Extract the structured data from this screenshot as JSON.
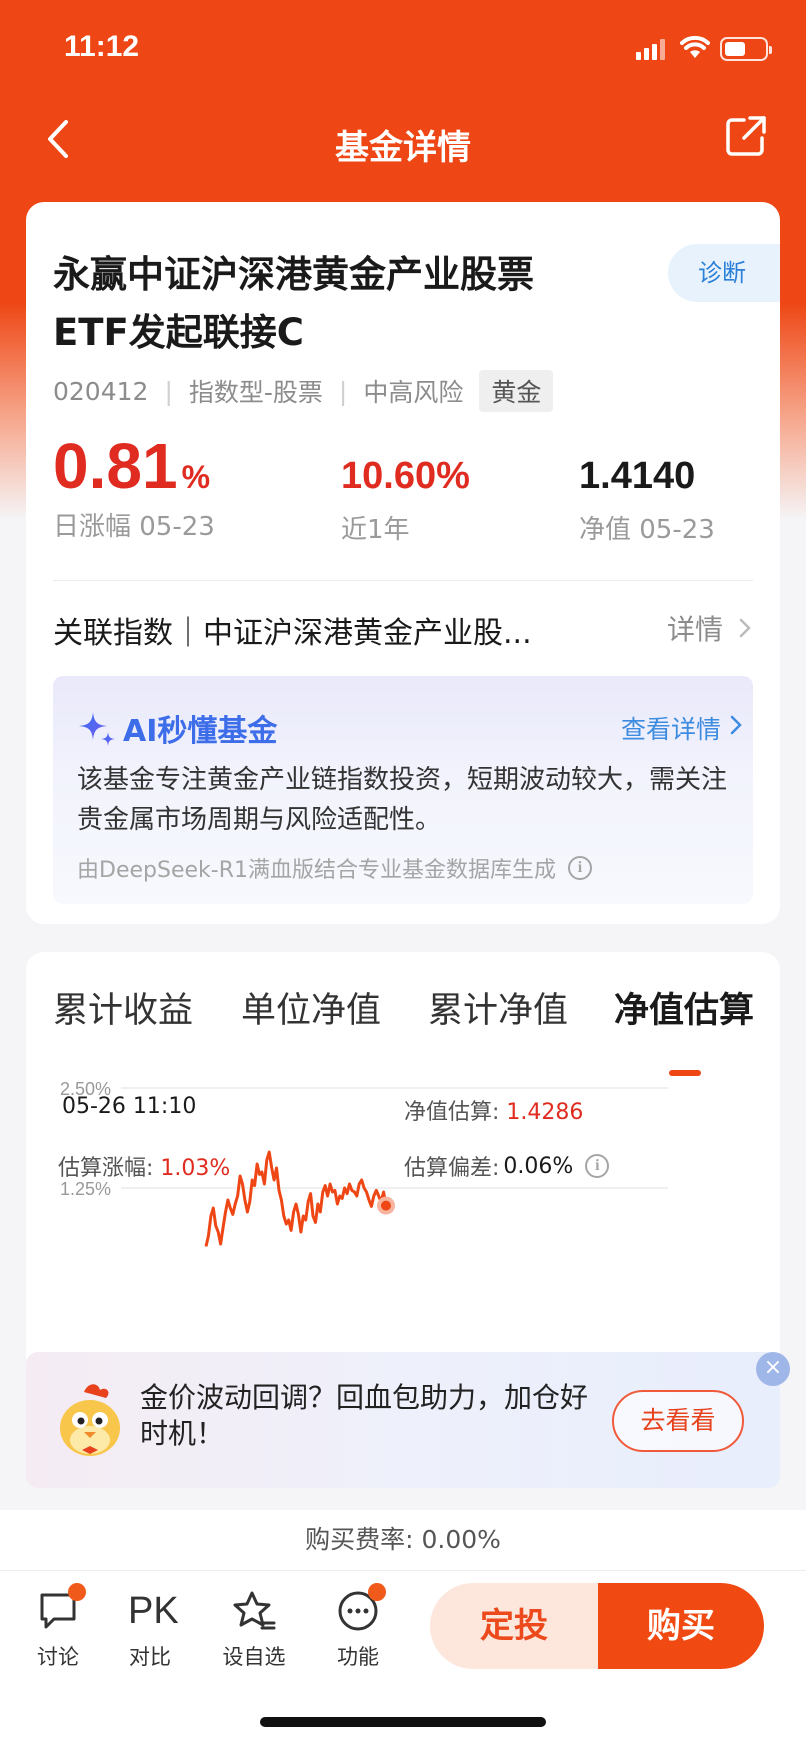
{
  "status_bar": {
    "time": "11:12"
  },
  "nav": {
    "title": "基金详情",
    "back_icon": "chevron-left-icon",
    "share_icon": "share-icon"
  },
  "fund": {
    "name": "永赢中证沪深港黄金产业股票ETF发起联接C",
    "diagnose_label": "诊断",
    "code": "020412",
    "type": "指数型-股票",
    "risk": "中高风险",
    "tag": "黄金",
    "daily_change_value": "0.81",
    "daily_change_unit": "%",
    "daily_change_label": "日涨幅 05-23",
    "year_return_value": "10.60%",
    "year_return_label": "近1年",
    "nav_value": "1.4140",
    "nav_label": "净值 05-23",
    "related_index": "关联指数｜中证沪深港黄金产业股...",
    "related_more": "详情"
  },
  "ai": {
    "title": "AI秒懂基金",
    "more": "查看详情",
    "text": "该基金专注黄金产业链指数投资，短期波动较大，需关注贵金属市场周期与风险适配性。",
    "footer": "由DeepSeek-R1满血版结合专业基金数据库生成"
  },
  "chart_tabs": [
    "累计收益",
    "单位净值",
    "累计净值",
    "净值估算"
  ],
  "active_tab": 3,
  "estimate": {
    "time": "05-26 11:10",
    "est_label": "净值估算:",
    "est_value": "1.4286",
    "change_label": "估算涨幅:",
    "change_value": "1.03%",
    "dev_label": "估算偏差:",
    "dev_value": "0.06%"
  },
  "chart_data": {
    "type": "line",
    "title": "",
    "xlabel": "",
    "ylabel": "",
    "ytick_labels": [
      "2.50%",
      "1.25%"
    ],
    "ylim": [
      0,
      2.5
    ],
    "color": "#ee4614",
    "series": [
      {
        "values": [
          0.52,
          0.65,
          0.9,
          1.0,
          0.78,
          0.7,
          0.55,
          0.75,
          0.95,
          1.1,
          1.0,
          0.92,
          1.05,
          1.15,
          1.4,
          1.3,
          1.1,
          0.95,
          1.08,
          1.35,
          1.28,
          1.55,
          1.42,
          1.45,
          1.3,
          1.6,
          1.7,
          1.5,
          1.35,
          1.5,
          1.22,
          1.1,
          0.9,
          0.8,
          0.85,
          0.72,
          0.95,
          1.05,
          0.92,
          0.7,
          0.9,
          0.85,
          1.08,
          1.18,
          0.9,
          0.82,
          1.05,
          0.95,
          1.2,
          1.28,
          1.15,
          1.3,
          1.2,
          1.22,
          1.05,
          1.15,
          1.12,
          1.25,
          1.18,
          1.3,
          1.22,
          1.2,
          1.15,
          1.3,
          1.35,
          1.25,
          1.2,
          1.1,
          1.02,
          1.15,
          1.22,
          1.15,
          1.08,
          1.2,
          1.03
        ]
      }
    ]
  },
  "promo": {
    "text": "金价波动回调？回血包助力，加仓好时机！",
    "button": "去看看",
    "close": "×"
  },
  "fee": "购买费率: 0.00%",
  "bottom": {
    "discuss": "讨论",
    "compare_icon_text": "PK",
    "compare": "对比",
    "watch": "设自选",
    "func": "功能",
    "sip": "定投",
    "buy": "购买"
  }
}
